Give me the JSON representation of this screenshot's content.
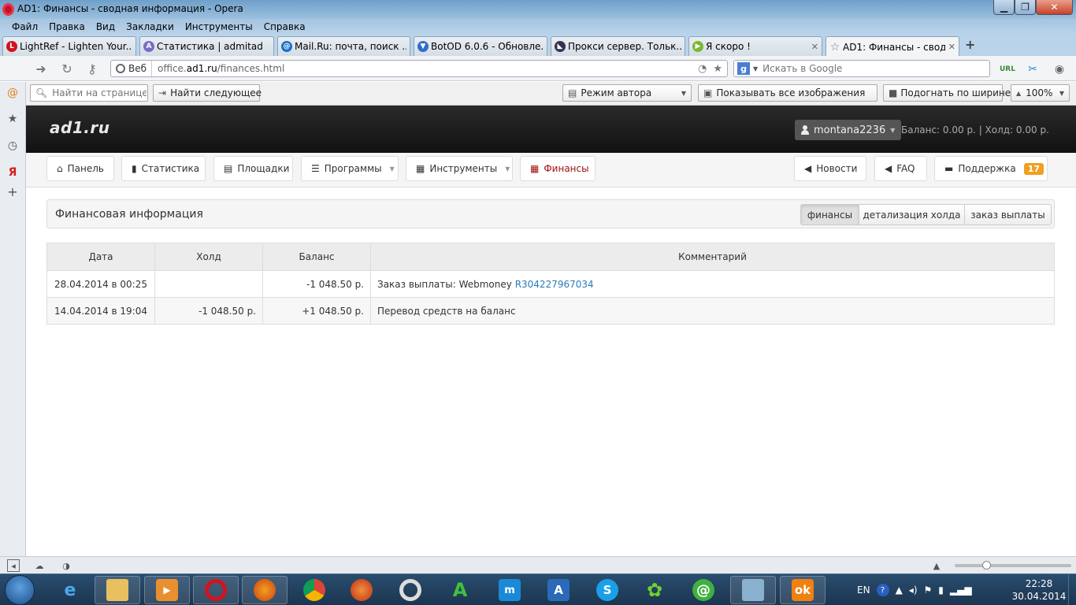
{
  "window": {
    "title": "AD1: Финансы - сводная информация - Opera"
  },
  "menu": [
    "Файл",
    "Правка",
    "Вид",
    "Закладки",
    "Инструменты",
    "Справка"
  ],
  "tabs": [
    {
      "label": "LightRef - Lighten Your...",
      "icon": "lightref-icon",
      "color": "#d0141e"
    },
    {
      "label": "Статистика | admitad",
      "icon": "admitad-icon",
      "color": "#7b6bc4"
    },
    {
      "label": "Mail.Ru: почта, поиск ...",
      "icon": "mailru-icon",
      "color": "#1a70c8"
    },
    {
      "label": "BotOD 6.0.6 - Обновле...",
      "icon": "botod-icon",
      "color": "#2f6fc8"
    },
    {
      "label": "Прокси сервер. Тольк...",
      "icon": "proxy-icon",
      "color": "#335"
    },
    {
      "label": "Я скоро !",
      "icon": "play-icon",
      "color": "#7ab832"
    },
    {
      "label": "AD1: Финансы - сводн...",
      "icon": "star-icon",
      "color": "#888"
    }
  ],
  "address": {
    "web_label": "Веб",
    "url_prefix": "office.",
    "url_domain": "ad1.ru",
    "url_path": "/finances.html"
  },
  "search": {
    "placeholder": "Искать в Google",
    "engine": "g"
  },
  "findbar": {
    "find_placeholder": "Найти на странице",
    "find_next": "Найти следующее",
    "author_mode": "Режим автора",
    "show_images": "Показывать все изображения",
    "fit_width": "Подогнать по ширине",
    "zoom": "100%"
  },
  "site": {
    "logo": "ad1.ru",
    "username": "montana2236",
    "balance_text": "Баланс: 0.00 р.  |  Холд: 0.00 р."
  },
  "site_nav": [
    {
      "label": "Панель",
      "icon": "home-icon"
    },
    {
      "label": "Статистика",
      "icon": "bar-chart-icon"
    },
    {
      "label": "Площадки",
      "icon": "list-icon"
    },
    {
      "label": "Программы",
      "icon": "menu-icon",
      "dropdown": true
    },
    {
      "label": "Инструменты",
      "icon": "grid-icon",
      "dropdown": true
    },
    {
      "label": "Финансы",
      "icon": "calendar-icon",
      "active": true
    },
    {
      "label": "Новости",
      "icon": "megaphone-icon"
    },
    {
      "label": "FAQ",
      "icon": "megaphone-icon"
    },
    {
      "label": "Поддержка",
      "icon": "comment-icon",
      "badge": "17"
    }
  ],
  "section": {
    "title": "Финансовая информация",
    "tabs": [
      "финансы",
      "детализация холда",
      "заказ выплаты"
    ]
  },
  "table": {
    "headers": [
      "Дата",
      "Холд",
      "Баланс",
      "Комментарий"
    ],
    "rows": [
      {
        "date": "28.04.2014 в 00:25",
        "hold": "",
        "balance": "-1 048.50 р.",
        "comment": "Заказ выплаты: Webmoney ",
        "comment_link": "R304227967034"
      },
      {
        "date": "14.04.2014 в 19:04",
        "hold": "-1 048.50 р.",
        "balance": "+1 048.50 р.",
        "comment": "Перевод средств на баланс",
        "comment_link": ""
      }
    ]
  },
  "taskbar": {
    "lang": "EN",
    "time": "22:28",
    "date": "30.04.2014"
  },
  "colors": {
    "accent_red": "#a01010",
    "positive_green": "#2c8a2c",
    "link_blue": "#2a7ab8",
    "badge_orange": "#f0a020"
  }
}
